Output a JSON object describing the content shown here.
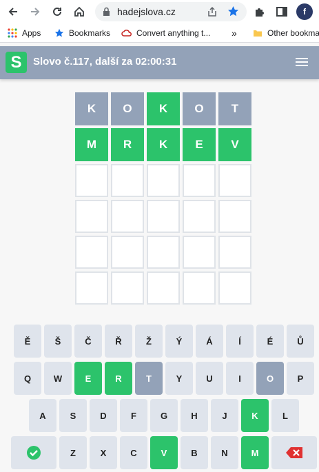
{
  "browser": {
    "url": "hadejslova.cz",
    "bookmarks": [
      {
        "label": "Apps",
        "icon": "apps-grid-icon"
      },
      {
        "label": "Bookmarks",
        "icon": "star-icon"
      },
      {
        "label": "Convert anything t...",
        "icon": "cloud-icon"
      },
      {
        "label": "Other bookmarks",
        "icon": "folder-icon"
      }
    ],
    "more_label": "»"
  },
  "app": {
    "logo_letter": "S",
    "title": "Slovo č.117, další za 02:00:31",
    "colors": {
      "header": "#93a2b8",
      "correct": "#2cc36b",
      "absent": "#93a2b8"
    }
  },
  "board": [
    [
      {
        "l": "K",
        "s": "gray"
      },
      {
        "l": "O",
        "s": "gray"
      },
      {
        "l": "K",
        "s": "green"
      },
      {
        "l": "O",
        "s": "gray"
      },
      {
        "l": "T",
        "s": "gray"
      }
    ],
    [
      {
        "l": "M",
        "s": "green"
      },
      {
        "l": "R",
        "s": "green"
      },
      {
        "l": "K",
        "s": "green"
      },
      {
        "l": "E",
        "s": "green"
      },
      {
        "l": "V",
        "s": "green"
      }
    ],
    [
      {
        "l": "",
        "s": ""
      },
      {
        "l": "",
        "s": ""
      },
      {
        "l": "",
        "s": ""
      },
      {
        "l": "",
        "s": ""
      },
      {
        "l": "",
        "s": ""
      }
    ],
    [
      {
        "l": "",
        "s": ""
      },
      {
        "l": "",
        "s": ""
      },
      {
        "l": "",
        "s": ""
      },
      {
        "l": "",
        "s": ""
      },
      {
        "l": "",
        "s": ""
      }
    ],
    [
      {
        "l": "",
        "s": ""
      },
      {
        "l": "",
        "s": ""
      },
      {
        "l": "",
        "s": ""
      },
      {
        "l": "",
        "s": ""
      },
      {
        "l": "",
        "s": ""
      }
    ],
    [
      {
        "l": "",
        "s": ""
      },
      {
        "l": "",
        "s": ""
      },
      {
        "l": "",
        "s": ""
      },
      {
        "l": "",
        "s": ""
      },
      {
        "l": "",
        "s": ""
      }
    ]
  ],
  "keyboard": {
    "row1": [
      {
        "l": "Ě",
        "s": ""
      },
      {
        "l": "Š",
        "s": ""
      },
      {
        "l": "Č",
        "s": ""
      },
      {
        "l": "Ř",
        "s": ""
      },
      {
        "l": "Ž",
        "s": ""
      },
      {
        "l": "Ý",
        "s": ""
      },
      {
        "l": "Á",
        "s": ""
      },
      {
        "l": "Í",
        "s": ""
      },
      {
        "l": "É",
        "s": ""
      },
      {
        "l": "Ů",
        "s": ""
      }
    ],
    "row2": [
      {
        "l": "Q",
        "s": ""
      },
      {
        "l": "W",
        "s": ""
      },
      {
        "l": "E",
        "s": "green"
      },
      {
        "l": "R",
        "s": "green"
      },
      {
        "l": "T",
        "s": "gray"
      },
      {
        "l": "Y",
        "s": ""
      },
      {
        "l": "U",
        "s": ""
      },
      {
        "l": "I",
        "s": ""
      },
      {
        "l": "O",
        "s": "gray"
      },
      {
        "l": "P",
        "s": ""
      }
    ],
    "row3": [
      {
        "l": "A",
        "s": ""
      },
      {
        "l": "S",
        "s": ""
      },
      {
        "l": "D",
        "s": ""
      },
      {
        "l": "F",
        "s": ""
      },
      {
        "l": "G",
        "s": ""
      },
      {
        "l": "H",
        "s": ""
      },
      {
        "l": "J",
        "s": ""
      },
      {
        "l": "K",
        "s": "green"
      },
      {
        "l": "L",
        "s": ""
      }
    ],
    "row4": [
      {
        "l": "Z",
        "s": ""
      },
      {
        "l": "X",
        "s": ""
      },
      {
        "l": "C",
        "s": ""
      },
      {
        "l": "V",
        "s": "green"
      },
      {
        "l": "B",
        "s": ""
      },
      {
        "l": "N",
        "s": ""
      },
      {
        "l": "M",
        "s": "green"
      }
    ],
    "enter_icon": "checkmark-icon",
    "backspace_icon": "backspace-icon"
  }
}
